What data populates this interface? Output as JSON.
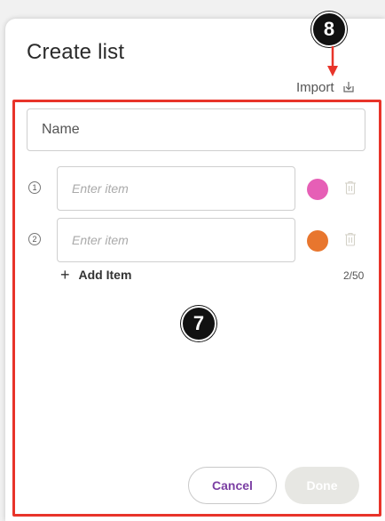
{
  "dialog": {
    "title": "Create list",
    "import_label": "Import",
    "name_placeholder": "Name",
    "items": [
      {
        "number": "1",
        "placeholder": "Enter item",
        "color": "#e65fb6"
      },
      {
        "number": "2",
        "placeholder": "Enter item",
        "color": "#e8762e"
      }
    ],
    "add_item_label": "Add Item",
    "counter": "2/50",
    "cancel_label": "Cancel",
    "done_label": "Done"
  },
  "annotations": {
    "callout_main": "7",
    "callout_import": "8",
    "highlight_color": "#e8342a"
  },
  "icons": {
    "import": "download-tray-icon",
    "add": "plus-icon",
    "delete": "trash-icon"
  }
}
